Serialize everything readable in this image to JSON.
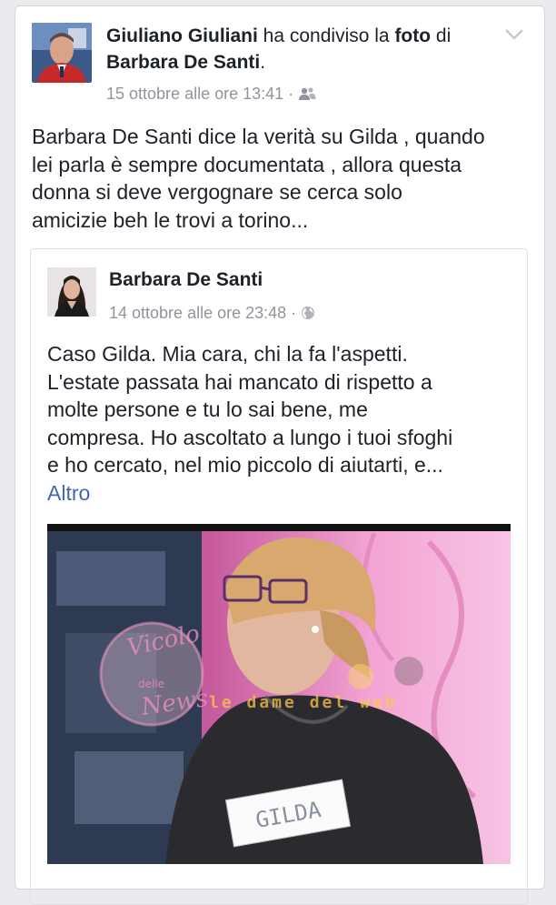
{
  "post": {
    "author": "Giuliano Giuliani",
    "action": " ha condiviso la ",
    "object": "foto",
    "prep": " di",
    "target": "Barbara De Santi",
    "target_suffix": ".",
    "time": "15 ottobre alle ore 13:41",
    "time_sep": " · ",
    "privacy_icon": "friends-icon",
    "text_lines": [
      "Barbara De Santi dice la verità su Gilda , quando",
      "lei parla è sempre documentata , allora questa",
      "donna si deve vergognare se cerca solo",
      "amicizie beh le trovi a torino..."
    ]
  },
  "shared": {
    "author": "Barbara De Santi",
    "time": "14 ottobre alle ore 23:48",
    "time_sep": " · ",
    "privacy_icon": "globe-icon",
    "text_lines": [
      "Caso Gilda. Mia cara, chi la fa l'aspetti.",
      "L'estate passata hai mancato di rispetto a",
      "molte persone e tu lo sai bene, me",
      "compresa. Ho ascoltato a lungo i tuoi sfoghi",
      "e ho cercato, nel mio piccolo di aiutarti, e..."
    ],
    "more_label": "Altro",
    "photo": {
      "name_tag": "GILDA",
      "watermark_left_line1": "Vicolo",
      "watermark_left_line2": "delle",
      "watermark_left_line3": "News",
      "watermark_right": "le dame del web"
    }
  },
  "colors": {
    "link": "#4267b2",
    "meta": "#90949c",
    "text": "#1d2129"
  }
}
